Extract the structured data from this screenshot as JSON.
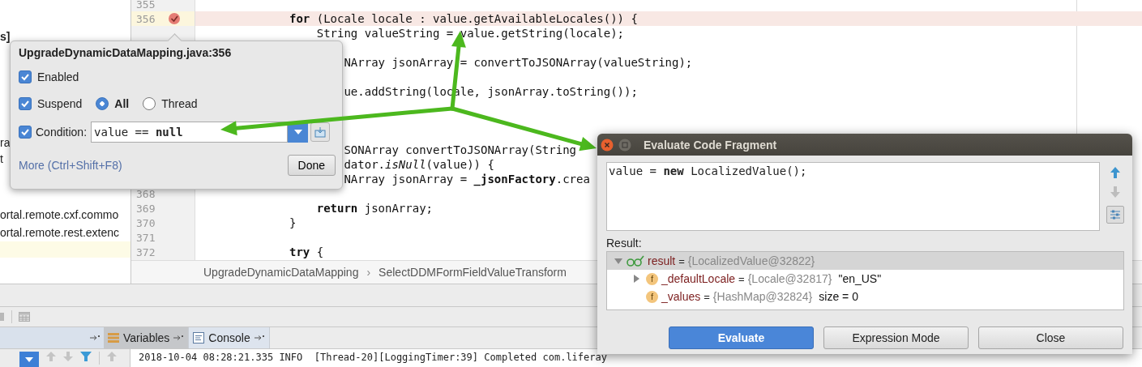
{
  "project_panel": {
    "items": [
      {
        "text": "s]",
        "bold": true
      },
      {
        "text": "ra",
        "bold": false
      },
      {
        "text": "t",
        "bold": false
      },
      {
        "text": "ortal.remote.cxf.commo",
        "bold": false
      },
      {
        "text": "ortal.remote.rest.extenc",
        "bold": false
      }
    ]
  },
  "editor": {
    "lines": [
      {
        "number": "355"
      },
      {
        "number": "356",
        "breakpoint": true,
        "code": "**for** (Locale locale : value.getAvailableLocales()) {"
      },
      {
        "code": "String valueString = value.getString(locale);"
      },
      {
        "code": "NArray jsonArray = convertToJSONArray(valueString);"
      },
      {
        "code": "ue.addString(locale, jsonArray.toString());"
      },
      {
        "code": "SONArray convertToJSONArray(String"
      },
      {
        "code": "dator.*isNull*(value)) {"
      },
      {
        "code": "NArray jsonArray = **_jsonFactory**.crea"
      },
      {
        "number": "368"
      },
      {
        "number": "369",
        "code": "**return** jsonArray;"
      },
      {
        "number": "370",
        "code": "}"
      },
      {
        "number": "371"
      },
      {
        "number": "372",
        "code": "**try** {"
      }
    ],
    "breadcrumb": [
      "UpgradeDynamicDataMapping",
      "SelectDDMFormFieldValueTransform"
    ],
    "breadcrumb_separator": "›"
  },
  "debug_panel": {
    "tabs": [
      {
        "label": "Variables",
        "selected": true
      },
      {
        "label": "Console",
        "selected": false
      }
    ],
    "console_lines": [
      "2018-10-04 08:28:21.335 INFO  [Thread-20][LoggingTimer:39] Completed com.liferay"
    ]
  },
  "breakpoint_popup": {
    "title": "UpgradeDynamicDataMapping.java:356",
    "enabled": {
      "label": "Enabled",
      "checked": true
    },
    "suspend": {
      "label": "Suspend",
      "checked": true
    },
    "suspend_options": [
      {
        "label": "All",
        "selected": true
      },
      {
        "label": "Thread",
        "selected": false
      }
    ],
    "condition": {
      "label": "Condition:",
      "checked": true,
      "value": "value == **null**"
    },
    "more_link": "More (Ctrl+Shift+F8)",
    "done_button": "Done"
  },
  "evaluate_dialog": {
    "title": "Evaluate Code Fragment",
    "code": "value = **new** LocalizedValue();",
    "result_label": "Result:",
    "result_tree": [
      {
        "name": "result",
        "eq": "=",
        "value": "{LocalizedValue@32822}",
        "kind": "result",
        "expandable": true,
        "expanded": true,
        "selected": true,
        "children": [
          {
            "name": "_defaultLocale",
            "eq": "=",
            "value": "{Locale@32817}",
            "extra": "\"en_US\"",
            "kind": "field",
            "badge": "f",
            "expandable": true,
            "expanded": false,
            "selected": false
          },
          {
            "name": "_values",
            "eq": "=",
            "value": "{HashMap@32824}",
            "extra": "size = 0",
            "kind": "field",
            "badge": "f",
            "expandable": false,
            "selected": false
          }
        ]
      }
    ],
    "buttons": [
      {
        "label": "Evaluate",
        "primary": true
      },
      {
        "label": "Expression Mode",
        "primary": false
      },
      {
        "label": "Close",
        "primary": false
      }
    ]
  }
}
